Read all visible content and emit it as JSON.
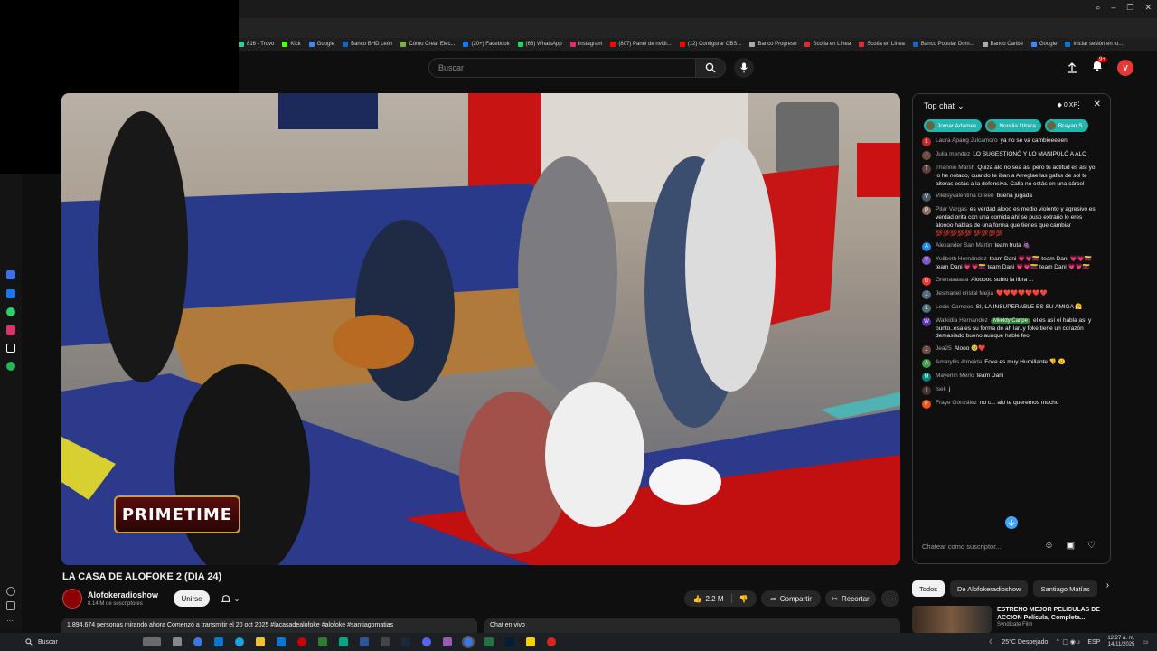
{
  "browser": {
    "bookmarks": [
      "816 - Trovo",
      "Kick",
      "Google",
      "Banco BHD León",
      "Cómo Crear Elec...",
      "(20+) Facebook",
      "(66) WhatsApp",
      "Instagram",
      "(807) Panel de nvidi...",
      "(12) Configurar OBS...",
      "Banco Progreso",
      "Scotia en Línea",
      "Scotia en Línea",
      "Banco Popular Dom...",
      "Banco Caribe",
      "Google",
      "Iniciar sesión en tu..."
    ]
  },
  "header": {
    "search_placeholder": "Buscar",
    "notification_count": "9+",
    "avatar_letter": "V"
  },
  "video": {
    "overlay_text": "PRIMETIME",
    "title": "LA CASA DE ALOFOKE 2 (DIA 24)",
    "channel_name": "Alofokeradioshow",
    "subscribers": "8.14 M de suscriptores",
    "join_label": "Unirse",
    "likes": "2.2 M",
    "share_label": "Compartir",
    "clip_label": "Recortar",
    "description_line": "1,894,674 personas mirando ahora  Comenzó a transmitir el 20 oct 2025  #lacasadealofoke #alofoke #santiagomatias",
    "chat_replay_label": "Chat en vivo"
  },
  "chat": {
    "header_title": "Top chat",
    "xp": "0 XP",
    "donors": [
      "Jomar Adames",
      "Norelia Utrera",
      "Brayan S"
    ],
    "messages": [
      {
        "author": "Laura Apang Julcamoro",
        "text": "ya no se va cambieeeeen",
        "color": "#c62828",
        "initial": "L"
      },
      {
        "author": "Julia mendez",
        "text": "LO SUGESTIONÓ Y LO MANIPULÓ A ALO",
        "color": "#6d4c41",
        "initial": "J"
      },
      {
        "author": "Thannie Marsh",
        "text": "Quiza alo no sea así pero tu actitud es así yo lo he notado, cuando te iban a Arreglae las gafas de sol te alteras estás a la defensiva. Calla no estás en una cárcel",
        "color": "#5d4037",
        "initial": "T"
      },
      {
        "author": "Vileisyvalentina Green",
        "text": "buena jugada",
        "color": "#455a64",
        "initial": "V"
      },
      {
        "author": "Pilar Vargas",
        "text": "es verdad alooo es medio violento y agresivo es verdad orita con una comida ahí se puso extraño lo eres aloooo hablas de una forma que tienes que cambiar 💯💯💯💯💯 💯💯💯💯",
        "color": "#8d6e63",
        "initial": "P"
      },
      {
        "author": "Alexander San Martin",
        "text": "team fruta 🍇",
        "color": "#1e88e5",
        "initial": "A"
      },
      {
        "author": "Yulibeth Hernández",
        "text": "team Dani 💗💗🇻🇪 team Dani 💗💗🇻🇪 team Dani 💗💗🇻🇪 team Dani 💗💗🇻🇪 team Dani 💗💗🇻🇪",
        "color": "#7e57c2",
        "initial": "Y"
      },
      {
        "author": "Grenaaaaaa",
        "text": "Alooooo subio la libra ...",
        "color": "#e53935",
        "initial": "G"
      },
      {
        "author": "Jesmariel cristal Mejia",
        "text": "❤️❤️❤️❤️❤️❤️❤️",
        "color": "#546e7a",
        "initial": "J"
      },
      {
        "author": "Ledis Campos",
        "text": "SI, LA INSUPERABLE ES SU AMIGA 🤗",
        "color": "#546e7a",
        "initial": "L"
      },
      {
        "author": "Walkidia Hernandez",
        "badge": "Miieldy Caripe",
        "text": "el es así el habla así y punto..esa es su forma de ah lar..y foke tiene un corazón demasiado bueno aunque hable feo",
        "color": "#5e35b1",
        "initial": "W"
      },
      {
        "author": "Jea25",
        "text": "Alooo 🥹❤️",
        "color": "#6d4c41",
        "initial": "J"
      },
      {
        "author": "Amaryllis Almeida",
        "text": "Foke es muy Humillante 👎 😕",
        "color": "#43a047",
        "initial": "A"
      },
      {
        "author": "Mayerlin Merlo",
        "text": "team Dani",
        "color": "#00897b",
        "initial": "M"
      },
      {
        "author": "Iseli",
        "text": "j",
        "color": "#4e342e",
        "initial": "I"
      },
      {
        "author": "Fraye González",
        "text": "no c... alo te queremos mucho",
        "color": "#f4511e",
        "initial": "F"
      }
    ],
    "input_placeholder": "Chatear como suscriptor..."
  },
  "sidebar_right": {
    "chips": [
      "Todos",
      "De Alofokeradioshow",
      "Santiago Matías"
    ],
    "rec_title": "ESTRENO MEJOR PELICULAS DE ACCION Película, Completa...",
    "rec_channel": "Syndicate Film"
  },
  "taskbar": {
    "search_label": "Buscar",
    "weather": "25°C  Despejado",
    "lang": "ESP",
    "time": "12:27 a. m.",
    "date": "14/11/2025"
  }
}
